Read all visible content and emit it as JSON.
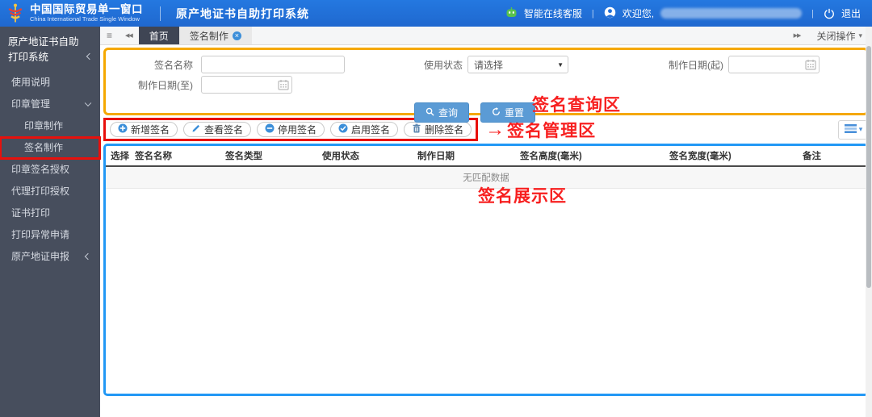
{
  "header": {
    "brand_title": "中国国际贸易单一窗口",
    "brand_subtitle": "China International Trade Single Window",
    "app_title": "原产地证书自助打印系统",
    "service_label": "智能在线客服",
    "welcome_label": "欢迎您,",
    "logout_label": "退出"
  },
  "sidebar": {
    "title": "原产地证书自助打印系统",
    "items": [
      {
        "label": "使用说明"
      },
      {
        "label": "印章管理"
      },
      {
        "label": "印章制作"
      },
      {
        "label": "签名制作"
      },
      {
        "label": "印章签名授权"
      },
      {
        "label": "代理打印授权"
      },
      {
        "label": "证书打印"
      },
      {
        "label": "打印异常申请"
      },
      {
        "label": "原产地证申报"
      }
    ]
  },
  "tabbar": {
    "home_tab": "首页",
    "current_tab": "签名制作",
    "close_menu": "关闭操作"
  },
  "query": {
    "name_label": "签名名称",
    "name_value": "",
    "status_label": "使用状态",
    "status_value": "请选择",
    "date_from_label": "制作日期(起)",
    "date_from_value": "",
    "date_to_label": "制作日期(至)",
    "date_to_value": "",
    "search_label": "查询",
    "reset_label": "重置"
  },
  "toolbar": {
    "buttons": [
      {
        "label": "新增签名"
      },
      {
        "label": "查看签名"
      },
      {
        "label": "停用签名"
      },
      {
        "label": "启用签名"
      },
      {
        "label": "删除签名"
      }
    ]
  },
  "table": {
    "columns": [
      "选择",
      "签名名称",
      "签名类型",
      "使用状态",
      "制作日期",
      "签名高度(毫米)",
      "签名宽度(毫米)",
      "备注"
    ],
    "empty_text": "无匹配数据"
  },
  "annotations": {
    "query_area": "签名查询区",
    "manage_area": "签名管理区",
    "display_area": "签名展示区"
  },
  "icons": {
    "menu": "≡",
    "scroll_left": "◀◀",
    "scroll_right": "▶▶",
    "caret_down": "▾",
    "select_caret": "▼",
    "separator": "|"
  },
  "colors": {
    "header_blue": "#2272d9",
    "sidebar_dark": "#474e5d",
    "annotation_red": "#f71f1f",
    "annotation_orange": "#f5a800",
    "annotation_blue": "#2298f5",
    "accent_blue": "#3d8fd9",
    "button_blue": "#5b9bd5"
  }
}
